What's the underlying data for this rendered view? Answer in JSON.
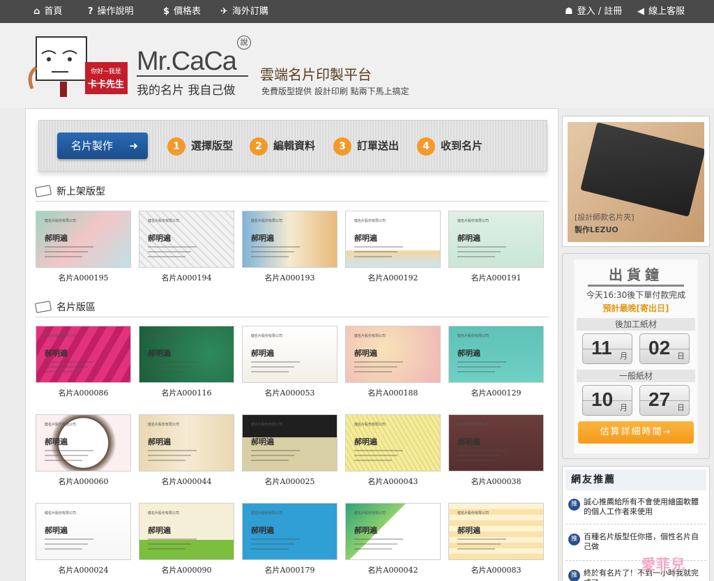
{
  "nav": {
    "left": [
      {
        "icon": "home-icon",
        "glyph": "⌂",
        "label": "首頁"
      },
      {
        "icon": "question-icon",
        "glyph": "?",
        "label": "操作說明"
      },
      {
        "icon": "dollar-icon",
        "glyph": "$",
        "label": "價格表"
      },
      {
        "icon": "plane-icon",
        "glyph": "✈",
        "label": "海外訂購"
      }
    ],
    "right": [
      {
        "icon": "user-icon",
        "glyph": "☗",
        "label": "登入 / 註冊"
      },
      {
        "icon": "speaker-icon",
        "glyph": "◀",
        "label": "線上客服"
      }
    ]
  },
  "header": {
    "mascot_line1": "你好~我是",
    "mascot_line2": "卡卡先生",
    "brand": "Mr.CaCa",
    "brand_badge": "說",
    "brand_sub": "我的名片  我自己做",
    "title": "雲端名片印製平台",
    "subtitle": "免費版型提供 設計印刷 點兩下馬上搞定"
  },
  "steps": {
    "make_button": "名片製作",
    "items": [
      {
        "num": "1",
        "label": "選擇版型"
      },
      {
        "num": "2",
        "label": "編輯資料"
      },
      {
        "num": "3",
        "label": "訂單送出"
      },
      {
        "num": "4",
        "label": "收到名片"
      }
    ]
  },
  "sections": {
    "new": "新上架版型",
    "all": "名片版區"
  },
  "card_text": {
    "company": "健名片股份有限公司",
    "name": "郝明遍"
  },
  "new_cards": [
    {
      "code": "名片A000195",
      "bg": "linear-gradient(135deg,#9fd3c2,#f2c6c6,#bfe0e8)"
    },
    {
      "code": "名片A000194",
      "bg": "repeating-linear-gradient(45deg,#f2f2f2 0 6px,#dcdcdc 6px 8px)"
    },
    {
      "code": "名片A000193",
      "bg": "linear-gradient(90deg,#7fb3d8,#f5ead0,#e7b97a)"
    },
    {
      "code": "名片A000192",
      "bg": "linear-gradient(#ffffff 70%,#f7d6a0 70%,#c9e6f2)"
    },
    {
      "code": "名片A000191",
      "bg": "linear-gradient(#dff0e6,#c9e6d6)"
    }
  ],
  "all_cards": [
    {
      "code": "名片A000086",
      "bg": "repeating-linear-gradient(120deg,#e2327d 0 12px,#c21f66 12px 22px)"
    },
    {
      "code": "名片A000116",
      "bg": "radial-gradient(circle at 75% 50%,#2f8a5a,#1c5e3a)"
    },
    {
      "code": "名片A000053",
      "bg": "linear-gradient(#ffffff,#f3efe6)"
    },
    {
      "code": "名片A000188",
      "bg": "radial-gradient(circle at 40% 40%,#f7e3b8,#f0b6b6)"
    },
    {
      "code": "名片A000129",
      "bg": "linear-gradient(#5ec2b7,#6fd0c4)"
    },
    {
      "code": "名片A000060",
      "bg": "radial-gradient(circle,#ffffff 45%,#5e4b3c 46%,#fbeff0 60%)"
    },
    {
      "code": "名片A000044",
      "bg": "linear-gradient(90deg,#e9d8b2,#f5ead2,#e9d8b2)"
    },
    {
      "code": "名片A000025",
      "bg": "linear-gradient(#1f1f1f 40%,#d9cfa4 40%)"
    },
    {
      "code": "名片A000043",
      "bg": "repeating-linear-gradient(60deg,#f4eca0 0 4px,#e8dc78 4px 6px)"
    },
    {
      "code": "名片A000038",
      "bg": "linear-gradient(#6b3d3a,#553030)"
    },
    {
      "code": "名片A000024",
      "bg": "linear-gradient(#ffffff,#f6f6f6)"
    },
    {
      "code": "名片A000090",
      "bg": "linear-gradient(#f6efd7 65%,#7cbf3e 65%)"
    },
    {
      "code": "名片A000179",
      "bg": "linear-gradient(#2f9fd6,#2f9fd6)"
    },
    {
      "code": "名片A000042",
      "bg": "linear-gradient(135deg,#2fa37d,#8fd16b 40%,#ffffff 40%)"
    },
    {
      "code": "名片A000083",
      "bg": "repeating-linear-gradient(0deg,#f8e3a8 0 8px,#fdf2d4 8px 16px)"
    }
  ],
  "promo": {
    "caption": "[設計師款名片夾]",
    "maker": "製作LEZUO"
  },
  "shipping": {
    "title": "出貨鐘",
    "line1": "今天16:30後下單付款完成",
    "line2": "預計最晚[寄出日]",
    "post_label": "後加工紙材",
    "post_month": "11",
    "post_day": "02",
    "normal_label": "一般紙材",
    "normal_month": "10",
    "normal_day": "27",
    "month_unit": "月",
    "day_unit": "日",
    "button": "估算詳細時間→"
  },
  "recs": {
    "title": "網友推薦",
    "badge": "推",
    "items": [
      "誠心推薦給所有不會使用繪圖軟體的個人工作者來使用",
      "百種名片版型任你搭，個性名片自己做",
      "終於有名片了！不到一小時我就完成了"
    ]
  },
  "watermark": "愛菲兒"
}
